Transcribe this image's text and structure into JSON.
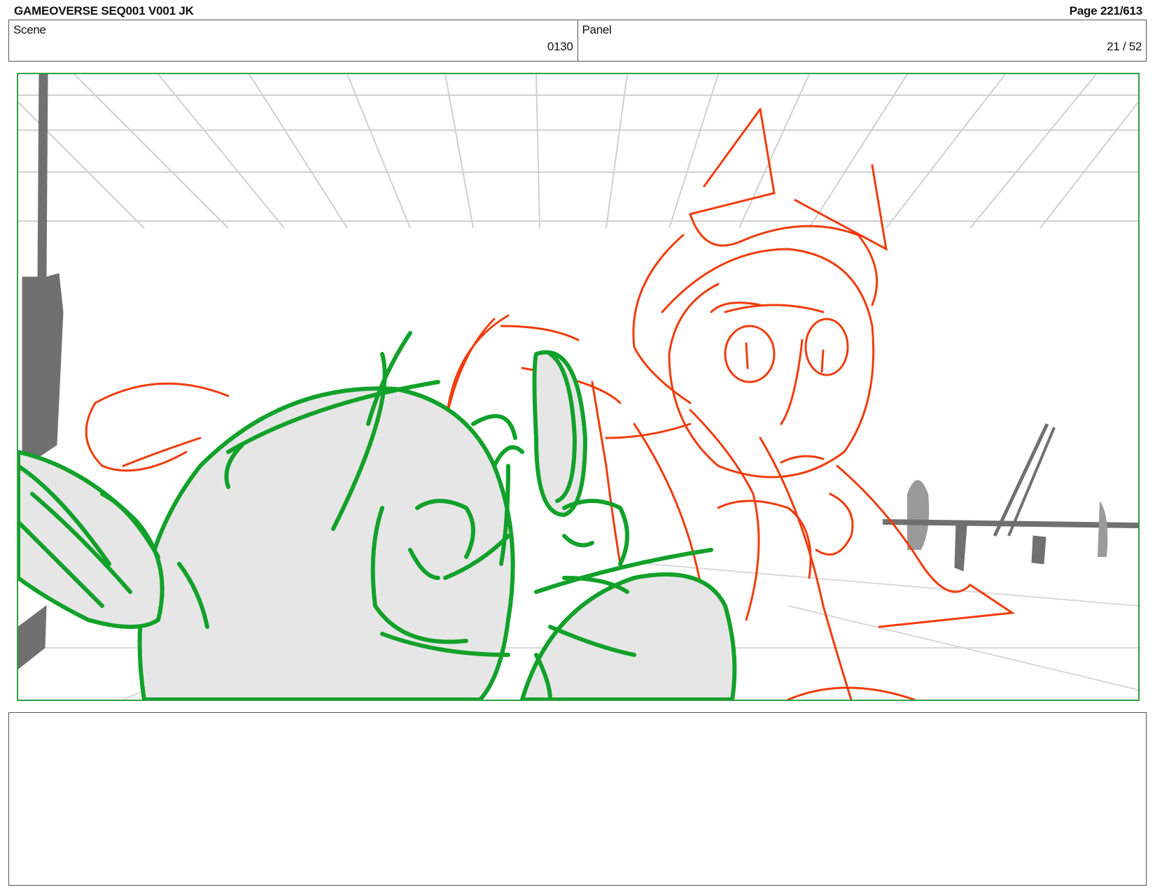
{
  "header": {
    "title": "GAMEOVERSE SEQ001 V001 JK",
    "page": "Page 221/613"
  },
  "info": {
    "scene_label": "Scene",
    "scene_value": "0130",
    "panel_label": "Panel",
    "panel_value": "21 / 52"
  },
  "sketch": {
    "colors": {
      "grid": "#d0d0d0",
      "foreground_character": "#12a12a",
      "background_character": "#f03c0c",
      "fill": "#e6e6e6",
      "props": "#707070",
      "frame": "#2ea043"
    }
  },
  "notes": {
    "text": ""
  }
}
